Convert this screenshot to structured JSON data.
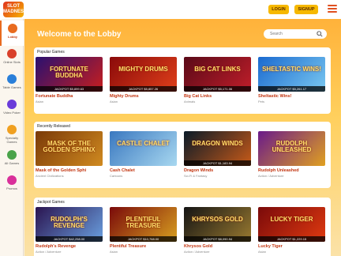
{
  "header": {
    "logo_text": "SLOT MADNESS",
    "login_label": "LOGIN",
    "signup_label": "SIGNUP",
    "menu_icon": "hamburger-icon"
  },
  "sidebar": {
    "items": [
      {
        "label": "Lobby",
        "icon": "home-icon",
        "color": "#e86b1f",
        "active": true
      },
      {
        "label": "Online Slots",
        "icon": "slot-machine-icon",
        "color": "#d9402a"
      },
      {
        "label": "Table Games",
        "icon": "cards-icon",
        "color": "#2a7fd9"
      },
      {
        "label": "Video Poker",
        "icon": "poker-chip-icon",
        "color": "#6a3bd9"
      },
      {
        "label": "Specialty Games",
        "icon": "specialty-icon",
        "color": "#f0a020"
      },
      {
        "label": "All Games",
        "icon": "grid-icon",
        "color": "#4aa34a"
      },
      {
        "label": "Promos",
        "icon": "gift-icon",
        "color": "#d9309a"
      }
    ]
  },
  "main": {
    "welcome": "Welcome to the Lobby",
    "search_placeholder": "Search",
    "sections": [
      {
        "title": "Popular Games",
        "games": [
          {
            "thumb_title": "FORTUNATE BUDDHA",
            "jackpot": "JACKPOT $5,899.63",
            "name": "Fortunate Buddha",
            "category": "Asian",
            "bg": [
              "#2a1070",
              "#c81e1e"
            ]
          },
          {
            "thumb_title": "MIGHTY DRUMS",
            "jackpot": "JACKPOT $5,857.26",
            "name": "Mighty Drums",
            "category": "Asian",
            "bg": [
              "#8a0a0a",
              "#e0401a"
            ]
          },
          {
            "thumb_title": "BIG CAT LINKS",
            "jackpot": "JACKPOT $5,171.06",
            "name": "Big Cat Links",
            "category": "Animals",
            "bg": [
              "#5a0a18",
              "#c01e2a"
            ]
          },
          {
            "thumb_title": "SHELTASTIC WINS!",
            "jackpot": "JACKPOT $5,261.17",
            "name": "Sheltastic Wins!",
            "category": "Pets",
            "bg": [
              "#1a6ad0",
              "#7ac8f0"
            ]
          }
        ]
      },
      {
        "title": "Recently Released",
        "games": [
          {
            "thumb_title": "MASK OF THE GOLDEN SPHINX",
            "jackpot": "",
            "name": "Mask of the Golden Sphi",
            "category": "Ancient Civilizations",
            "bg": [
              "#7a3a08",
              "#d08a20"
            ]
          },
          {
            "thumb_title": "CASTLE CHALET",
            "jackpot": "",
            "name": "Cash Chalet",
            "category": "Cartoons",
            "bg": [
              "#3a78c0",
              "#a8d8f0"
            ]
          },
          {
            "thumb_title": "DRAGON WINDS",
            "jackpot": "JACKPOT $1,183.94",
            "name": "Dragon Winds",
            "category": "Sci-Fi & Fantasy",
            "bg": [
              "#0a1a28",
              "#c85a18"
            ]
          },
          {
            "thumb_title": "RUDOLPH UNLEASHED",
            "jackpot": "",
            "name": "Rudolph Unleashed",
            "category": "Action / Adventure",
            "bg": [
              "#6a1a8a",
              "#e0a020"
            ]
          }
        ]
      },
      {
        "title": "Jackpot Games",
        "games": [
          {
            "thumb_title": "RUDOLPH'S REVENGE",
            "jackpot": "JACKPOT $42,258.00",
            "name": "Rudolph's Revenge",
            "category": "Action / Adventure",
            "bg": [
              "#2a1450",
              "#6aa0e0"
            ]
          },
          {
            "thumb_title": "PLENTIFUL TREASURE",
            "jackpot": "JACKPOT $10,768.00",
            "name": "Plentiful Treasure",
            "category": "Asian",
            "bg": [
              "#7a0a0a",
              "#d8a020"
            ]
          },
          {
            "thumb_title": "KHRYSOS GOLD",
            "jackpot": "JACKPOT $8,090.94",
            "name": "Khrysos Gold",
            "category": "Action / Adventure",
            "bg": [
              "#141414",
              "#9a7a30"
            ]
          },
          {
            "thumb_title": "LUCKY TIGER",
            "jackpot": "JACKPOT $1,229.15",
            "name": "Lucky Tiger",
            "category": "Asian",
            "bg": [
              "#7a0a0a",
              "#e03a10"
            ]
          }
        ]
      }
    ]
  }
}
